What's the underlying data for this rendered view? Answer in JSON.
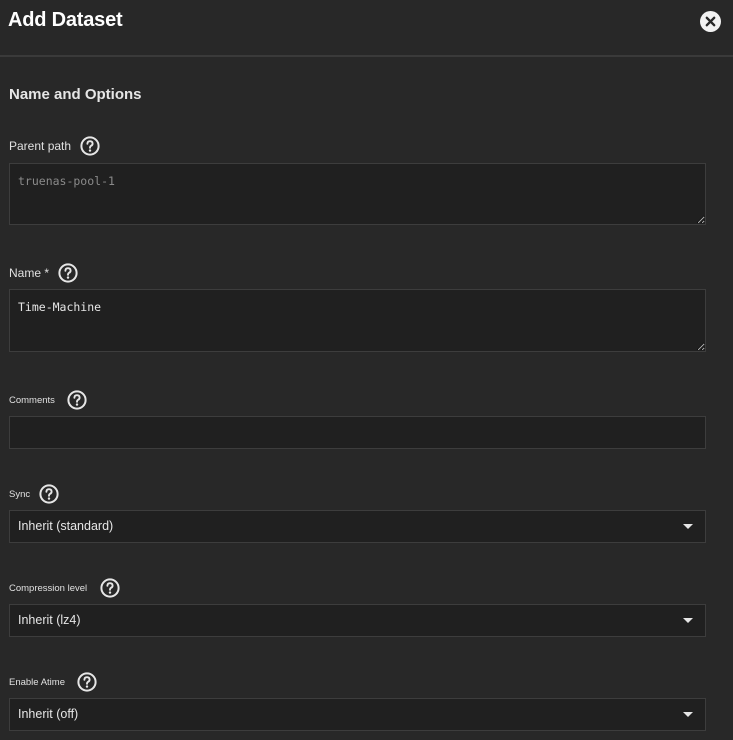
{
  "header": {
    "title": "Add Dataset",
    "close_icon": "close-icon"
  },
  "section": {
    "title": "Name and Options"
  },
  "fields": {
    "parent_path": {
      "label": "Parent path",
      "value": "truenas-pool-1",
      "help_icon": "help-icon"
    },
    "name": {
      "label": "Name *",
      "value": "Time-Machine",
      "help_icon": "help-icon"
    },
    "comments": {
      "label": "Comments",
      "value": "",
      "help_icon": "help-icon"
    },
    "sync": {
      "label": "Sync",
      "value": "Inherit (standard)",
      "help_icon": "help-icon"
    },
    "compression": {
      "label": "Compression level",
      "value": "Inherit (lz4)",
      "help_icon": "help-icon"
    },
    "atime": {
      "label": "Enable Atime",
      "value": "Inherit (off)",
      "help_icon": "help-icon"
    }
  },
  "colors": {
    "background": "#282828",
    "field_background": "#202020",
    "field_border": "#3d3d3d",
    "text": "#e6e6e6"
  }
}
